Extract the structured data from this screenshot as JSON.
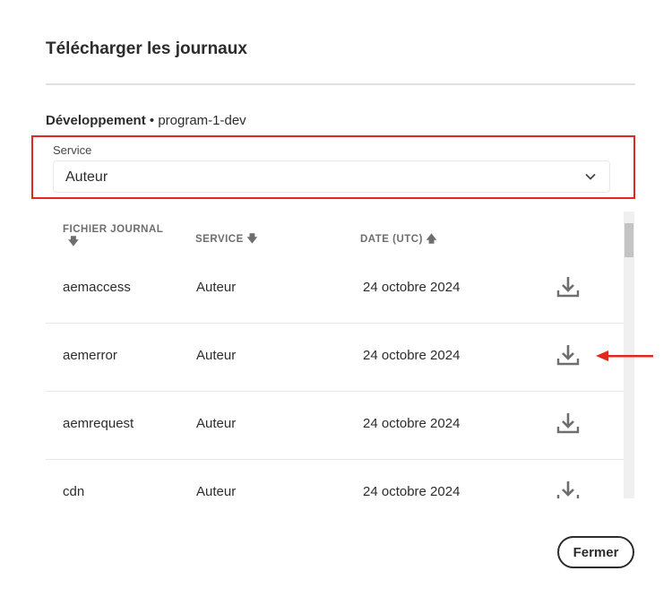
{
  "dialog": {
    "title": "Télécharger les journaux",
    "environment": "Développement",
    "separator": "•",
    "program": "program-1-dev",
    "close_label": "Fermer"
  },
  "service_select": {
    "label": "Service",
    "value": "Auteur"
  },
  "table": {
    "headers": {
      "file": "FICHIER JOURNAL",
      "service": "SERVICE",
      "date": "DATE (UTC)"
    },
    "sort_icons": {
      "file": "arrow-down-icon",
      "service": "arrow-down-icon",
      "date": "arrow-up-icon"
    },
    "rows": [
      {
        "file": "aemaccess",
        "service": "Auteur",
        "date": "24 octobre 2024"
      },
      {
        "file": "aemerror",
        "service": "Auteur",
        "date": "24 octobre 2024"
      },
      {
        "file": "aemrequest",
        "service": "Auteur",
        "date": "24 octobre 2024"
      },
      {
        "file": "cdn",
        "service": "Auteur",
        "date": "24 octobre 2024"
      }
    ]
  },
  "colors": {
    "highlight": "#e0281c",
    "icon": "#6e6e6e"
  }
}
